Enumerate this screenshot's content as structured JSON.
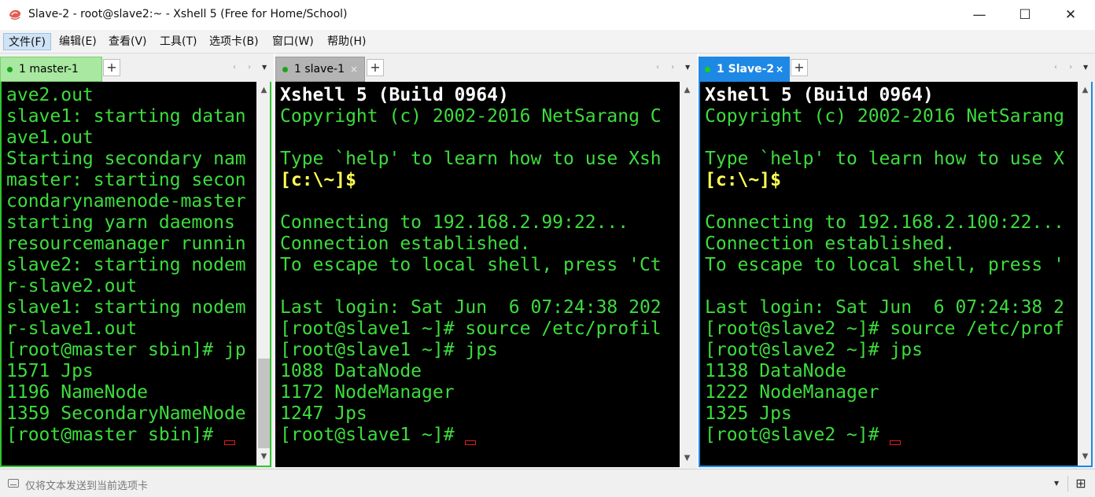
{
  "window": {
    "title": "Slave-2 - root@slave2:~ - Xshell 5 (Free for Home/School)",
    "minimize_glyph": "—",
    "maximize_glyph": "☐",
    "close_glyph": "✕"
  },
  "menu": {
    "items": [
      "文件(F)",
      "编辑(E)",
      "查看(V)",
      "工具(T)",
      "选项卡(B)",
      "窗口(W)",
      "帮助(H)"
    ],
    "active_index": 0
  },
  "tab_controls": {
    "new_tab_glyph": "+",
    "nav_glyph": "‹ ›",
    "menu_glyph": "▼",
    "close_glyph": "×"
  },
  "panes": [
    {
      "tab_label": "1 master-1",
      "tab_active": false,
      "tab_dot_color": "#19a519",
      "has_scrollbar": true,
      "lines": [
        {
          "text": "ave2.out",
          "style": "g"
        },
        {
          "text": "slave1: starting datan",
          "style": "g"
        },
        {
          "text": "ave1.out",
          "style": "g"
        },
        {
          "text": "Starting secondary nam",
          "style": "g"
        },
        {
          "text": "master: starting secon",
          "style": "g"
        },
        {
          "text": "condarynamenode-master",
          "style": "g"
        },
        {
          "text": "starting yarn daemons",
          "style": "g"
        },
        {
          "text": "resourcemanager runnin",
          "style": "g"
        },
        {
          "text": "slave2: starting nodem",
          "style": "g"
        },
        {
          "text": "r-slave2.out",
          "style": "g"
        },
        {
          "text": "slave1: starting nodem",
          "style": "g"
        },
        {
          "text": "r-slave1.out",
          "style": "g"
        },
        {
          "text": "[root@master sbin]# jp",
          "style": "g"
        },
        {
          "text": "1571 Jps",
          "style": "g"
        },
        {
          "text": "1196 NameNode",
          "style": "g"
        },
        {
          "text": "1359 SecondaryNameNode",
          "style": "g"
        },
        {
          "text": "[root@master sbin]#",
          "style": "g"
        }
      ]
    },
    {
      "tab_label": "1 slave-1",
      "tab_active": false,
      "tab_dot_color": "#19a519",
      "has_scrollbar": false,
      "lines": [
        {
          "text": "Xshell 5 (Build 0964)",
          "style": "w"
        },
        {
          "text": "Copyright (c) 2002-2016 NetSarang C",
          "style": "g"
        },
        {
          "text": "",
          "style": "g"
        },
        {
          "text": "Type `help' to learn how to use Xsh",
          "style": "g"
        },
        {
          "text": "[c:\\~]$",
          "style": "y"
        },
        {
          "text": "",
          "style": "g"
        },
        {
          "text": "Connecting to 192.168.2.99:22...",
          "style": "g"
        },
        {
          "text": "Connection established.",
          "style": "g"
        },
        {
          "text": "To escape to local shell, press 'Ct",
          "style": "g"
        },
        {
          "text": "",
          "style": "g"
        },
        {
          "text": "Last login: Sat Jun  6 07:24:38 202",
          "style": "g"
        },
        {
          "text": "[root@slave1 ~]# source /etc/profil",
          "style": "g"
        },
        {
          "text": "[root@slave1 ~]# jps",
          "style": "g"
        },
        {
          "text": "1088 DataNode",
          "style": "g"
        },
        {
          "text": "1172 NodeManager",
          "style": "g"
        },
        {
          "text": "1247 Jps",
          "style": "g"
        },
        {
          "text": "[root@slave1 ~]#",
          "style": "g"
        }
      ]
    },
    {
      "tab_label": "1 Slave-2",
      "tab_active": true,
      "tab_dot_color": "#19d219",
      "has_scrollbar": true,
      "lines": [
        {
          "text": "Xshell 5 (Build 0964)",
          "style": "w"
        },
        {
          "text": "Copyright (c) 2002-2016 NetSarang",
          "style": "g"
        },
        {
          "text": "",
          "style": "g"
        },
        {
          "text": "Type `help' to learn how to use X",
          "style": "g"
        },
        {
          "text": "[c:\\~]$",
          "style": "y"
        },
        {
          "text": "",
          "style": "g"
        },
        {
          "text": "Connecting to 192.168.2.100:22...",
          "style": "g"
        },
        {
          "text": "Connection established.",
          "style": "g"
        },
        {
          "text": "To escape to local shell, press '",
          "style": "g"
        },
        {
          "text": "",
          "style": "g"
        },
        {
          "text": "Last login: Sat Jun  6 07:24:38 2",
          "style": "g"
        },
        {
          "text": "[root@slave2 ~]# source /etc/prof",
          "style": "g"
        },
        {
          "text": "[root@slave2 ~]# jps",
          "style": "g"
        },
        {
          "text": "1138 DataNode",
          "style": "g"
        },
        {
          "text": "1222 NodeManager",
          "style": "g"
        },
        {
          "text": "1325 Jps",
          "style": "g"
        },
        {
          "text": "[root@slave2 ~]#",
          "style": "g"
        }
      ]
    }
  ],
  "colors": {
    "terminal_bg": "#000000",
    "terminal_fg": "#3ddc3d",
    "active_tab": "#1e88e5",
    "master_tab": "#a8e8a0",
    "slave1_tab": "#b4b4b4",
    "master_border": "#2fc52f",
    "cursor": "#e02020"
  },
  "status": {
    "text": "仅将文本发送到当前选项卡",
    "dropdown_glyph": "▼",
    "grip_glyph": "⊞"
  }
}
